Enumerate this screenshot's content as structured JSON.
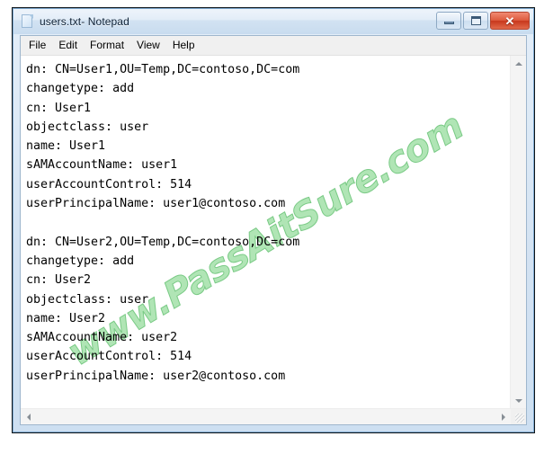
{
  "window": {
    "title": "users.txt- Notepad",
    "icon": "notepad-document-icon",
    "buttons": {
      "minimize": "minimize-icon",
      "maximize": "maximize-icon",
      "close": "✕"
    }
  },
  "menu": {
    "items": [
      {
        "label": "File"
      },
      {
        "label": "Edit"
      },
      {
        "label": "Format"
      },
      {
        "label": "View"
      },
      {
        "label": "Help"
      }
    ]
  },
  "document": {
    "lines": [
      "dn: CN=User1,OU=Temp,DC=contoso,DC=com",
      "changetype: add",
      "cn: User1",
      "objectclass: user",
      "name: User1",
      "sAMAccountName: user1",
      "userAccountControl: 514",
      "userPrincipalName: user1@contoso.com",
      "",
      "dn: CN=User2,OU=Temp,DC=contoso,DC=com",
      "changetype: add",
      "cn: User2",
      "objectclass: user",
      "name: User2",
      "sAMAccountName: user2",
      "userAccountControl: 514",
      "userPrincipalName: user2@contoso.com"
    ],
    "text": "dn: CN=User1,OU=Temp,DC=contoso,DC=com\nchangetype: add\ncn: User1\nobjectclass: user\nname: User1\nsAMAccountName: user1\nuserAccountControl: 514\nuserPrincipalName: user1@contoso.com\n\ndn: CN=User2,OU=Temp,DC=contoso,DC=com\nchangetype: add\ncn: User2\nobjectclass: user\nname: User2\nsAMAccountName: user2\nuserAccountControl: 514\nuserPrincipalName: user2@contoso.com"
  },
  "watermark": {
    "text": "www.PassAitSure.com",
    "color": "#9fe0a6"
  },
  "scrollbars": {
    "vertical": {
      "up": "scroll-up-icon",
      "down": "scroll-down-icon"
    },
    "horizontal": {
      "left": "scroll-left-icon",
      "right": "scroll-right-icon"
    },
    "grip": "resize-grip-icon"
  },
  "colors": {
    "title_bar": "#dce9f6",
    "frame_border": "#7fa9d0",
    "close_button": "#c8371c",
    "text": "#000000",
    "editor_background": "#ffffff"
  }
}
